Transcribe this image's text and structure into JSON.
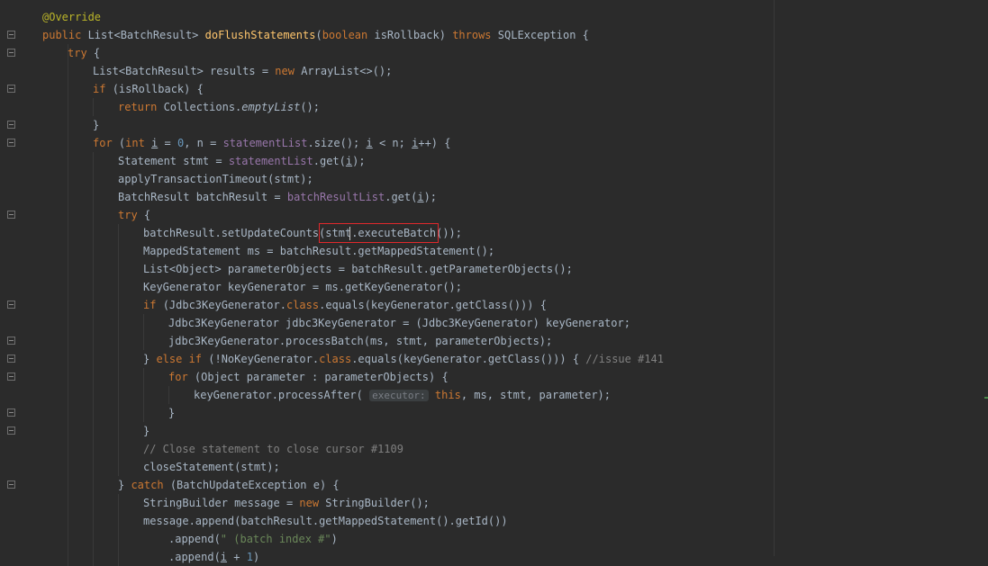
{
  "editor": {
    "language": "java",
    "lines": [
      {
        "indent": 0,
        "tokens": [
          [
            "ann",
            "@Override"
          ]
        ]
      },
      {
        "indent": 0,
        "tokens": [
          [
            "kw",
            "public "
          ],
          [
            "t",
            "List<BatchResult> "
          ],
          [
            "fn",
            "doFlushStatements"
          ],
          [
            "t",
            "("
          ],
          [
            "kw",
            "boolean "
          ],
          [
            "t",
            "isRollback) "
          ],
          [
            "kw",
            "throws "
          ],
          [
            "t",
            "SQLException {"
          ]
        ]
      },
      {
        "indent": 1,
        "tokens": [
          [
            "kw",
            "try "
          ],
          [
            "t",
            "{"
          ]
        ]
      },
      {
        "indent": 2,
        "tokens": [
          [
            "t",
            "List<BatchResult> results = "
          ],
          [
            "kw",
            "new "
          ],
          [
            "t",
            "ArrayList<>();"
          ]
        ]
      },
      {
        "indent": 2,
        "tokens": [
          [
            "kw",
            "if "
          ],
          [
            "t",
            "(isRollback) {"
          ]
        ]
      },
      {
        "indent": 3,
        "tokens": [
          [
            "kw",
            "return "
          ],
          [
            "t",
            "Collections."
          ],
          [
            "it",
            "emptyList"
          ],
          [
            "t",
            "();"
          ]
        ]
      },
      {
        "indent": 2,
        "tokens": [
          [
            "t",
            "}"
          ]
        ]
      },
      {
        "indent": 2,
        "tokens": [
          [
            "kw",
            "for "
          ],
          [
            "t",
            "("
          ],
          [
            "kw",
            "int "
          ],
          [
            "ul",
            "i"
          ],
          [
            "t",
            " = "
          ],
          [
            "num",
            "0"
          ],
          [
            "t",
            ", n = "
          ],
          [
            "fld",
            "statementList"
          ],
          [
            "t",
            ".size(); "
          ],
          [
            "ul",
            "i"
          ],
          [
            "t",
            " < n; "
          ],
          [
            "ul",
            "i"
          ],
          [
            "t",
            "++) {"
          ]
        ]
      },
      {
        "indent": 3,
        "tokens": [
          [
            "t",
            "Statement stmt = "
          ],
          [
            "fld",
            "statementList"
          ],
          [
            "t",
            ".get("
          ],
          [
            "ul",
            "i"
          ],
          [
            "t",
            ");"
          ]
        ]
      },
      {
        "indent": 3,
        "tokens": [
          [
            "t",
            "applyTransactionTimeout(stmt);"
          ]
        ]
      },
      {
        "indent": 3,
        "tokens": [
          [
            "t",
            "BatchResult batchResult = "
          ],
          [
            "fld",
            "batchResultList"
          ],
          [
            "t",
            ".get("
          ],
          [
            "ul",
            "i"
          ],
          [
            "t",
            ");"
          ]
        ]
      },
      {
        "indent": 3,
        "tokens": [
          [
            "kw",
            "try "
          ],
          [
            "t",
            "{"
          ]
        ]
      },
      {
        "indent": 4,
        "tokens": [
          [
            "t",
            "batchResult.setUpdateCounts(stmt.executeBatch());"
          ]
        ]
      },
      {
        "indent": 4,
        "tokens": [
          [
            "t",
            "MappedStatement ms = batchResult.getMappedStatement();"
          ]
        ]
      },
      {
        "indent": 4,
        "tokens": [
          [
            "t",
            "List<Object> parameterObjects = batchResult.getParameterObjects();"
          ]
        ]
      },
      {
        "indent": 4,
        "tokens": [
          [
            "t",
            "KeyGenerator keyGenerator = ms.getKeyGenerator();"
          ]
        ]
      },
      {
        "indent": 4,
        "tokens": [
          [
            "kw",
            "if "
          ],
          [
            "t",
            "(Jdbc3KeyGenerator."
          ],
          [
            "kw",
            "class"
          ],
          [
            "t",
            ".equals(keyGenerator.getClass())) {"
          ]
        ]
      },
      {
        "indent": 5,
        "tokens": [
          [
            "t",
            "Jdbc3KeyGenerator jdbc3KeyGenerator = (Jdbc3KeyGenerator) keyGenerator;"
          ]
        ]
      },
      {
        "indent": 5,
        "tokens": [
          [
            "t",
            "jdbc3KeyGenerator.processBatch(ms, stmt, parameterObjects);"
          ]
        ]
      },
      {
        "indent": 4,
        "tokens": [
          [
            "t",
            "} "
          ],
          [
            "kw",
            "else if "
          ],
          [
            "t",
            "(!NoKeyGenerator."
          ],
          [
            "kw",
            "class"
          ],
          [
            "t",
            ".equals(keyGenerator.getClass())) { "
          ],
          [
            "cmt",
            "//issue #141"
          ]
        ]
      },
      {
        "indent": 5,
        "tokens": [
          [
            "kw",
            "for "
          ],
          [
            "t",
            "(Object parameter : parameterObjects) {"
          ]
        ]
      },
      {
        "indent": 6,
        "tokens": [
          [
            "t",
            "keyGenerator.processAfter( "
          ],
          [
            "hint",
            "executor:"
          ],
          [
            "t",
            " "
          ],
          [
            "kw",
            "this"
          ],
          [
            "t",
            ", ms, stmt, parameter);"
          ]
        ]
      },
      {
        "indent": 5,
        "tokens": [
          [
            "t",
            "}"
          ]
        ]
      },
      {
        "indent": 4,
        "tokens": [
          [
            "t",
            "}"
          ]
        ]
      },
      {
        "indent": 4,
        "tokens": [
          [
            "cmt",
            "// Close statement to close cursor #1109"
          ]
        ]
      },
      {
        "indent": 4,
        "tokens": [
          [
            "t",
            "closeStatement(stmt);"
          ]
        ]
      },
      {
        "indent": 3,
        "tokens": [
          [
            "t",
            "} "
          ],
          [
            "kw",
            "catch "
          ],
          [
            "t",
            "(BatchUpdateException e) {"
          ]
        ]
      },
      {
        "indent": 4,
        "tokens": [
          [
            "t",
            "StringBuilder message = "
          ],
          [
            "kw",
            "new "
          ],
          [
            "t",
            "StringBuilder();"
          ]
        ]
      },
      {
        "indent": 4,
        "tokens": [
          [
            "t",
            "message.append(batchResult.getMappedStatement().getId())"
          ]
        ]
      },
      {
        "indent": 5,
        "tokens": [
          [
            "t",
            ".append("
          ],
          [
            "str",
            "\" (batch index #\""
          ],
          [
            "t",
            ")"
          ]
        ]
      },
      {
        "indent": 5,
        "tokens": [
          [
            "t",
            ".append("
          ],
          [
            "ul",
            "i"
          ],
          [
            "t",
            " + "
          ],
          [
            "num",
            "1"
          ],
          [
            "t",
            ")"
          ]
        ]
      }
    ]
  },
  "colors": {
    "background": "#2b2b2b",
    "keyword": "#cc7832",
    "annotation": "#bbb529",
    "method_decl": "#ffc66d",
    "field": "#9876aa",
    "number": "#6897bb",
    "string": "#6a8759",
    "comment": "#808080",
    "highlight_border": "#e0282c"
  }
}
